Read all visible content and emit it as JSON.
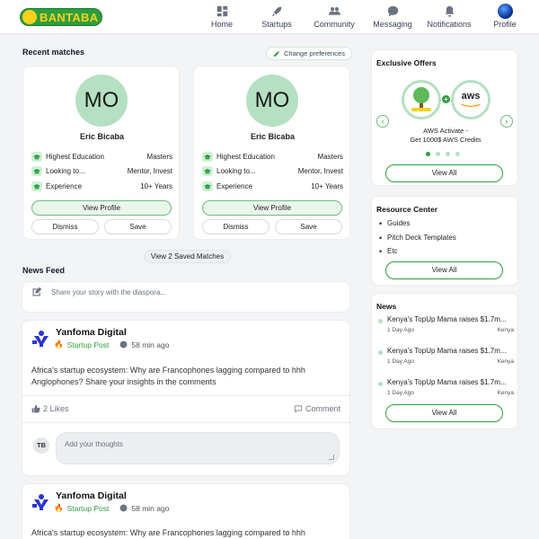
{
  "brand": {
    "name": "BANTABA",
    "primary": "#2e9e3e",
    "accent": "#f7d11e",
    "soft": "#b5e0c2"
  },
  "nav": [
    {
      "label": "Home",
      "icon": "home-icon"
    },
    {
      "label": "Startups",
      "icon": "rocket-icon"
    },
    {
      "label": "Community",
      "icon": "community-icon"
    },
    {
      "label": "Messaging",
      "icon": "chat-icon"
    },
    {
      "label": "Notifications",
      "icon": "bell-icon"
    },
    {
      "label": "Profile",
      "icon": "avatar"
    }
  ],
  "recent_matches": {
    "title": "Recent matches",
    "change_prefs": "Change preferences",
    "cards": [
      {
        "initials": "MO",
        "name": "Eric Bicaba",
        "attrs": [
          {
            "label": "Highest Education",
            "value": "Masters"
          },
          {
            "label": "Looking to...",
            "value": "Mentor, Invest"
          },
          {
            "label": "Experience",
            "value": "10+ Years"
          }
        ],
        "view": "View Profile",
        "dismiss": "Dismiss",
        "save": "Save"
      },
      {
        "initials": "MO",
        "name": "Eric Bicaba",
        "attrs": [
          {
            "label": "Highest Education",
            "value": "Masters"
          },
          {
            "label": "Looking to...",
            "value": "Mentor, Invest"
          },
          {
            "label": "Experience",
            "value": "10+ Years"
          }
        ],
        "view": "View Profile",
        "dismiss": "Dismiss",
        "save": "Save"
      }
    ],
    "saved_btn": "View 2 Saved Matches"
  },
  "news_feed": {
    "title": "News Feed",
    "share_placeholder": "Share your story with the diaspora...",
    "posts": [
      {
        "author": "Yanfoma Digital",
        "tag": "Startup Post",
        "time": "58 min ago",
        "body": "Africa's startup ecosystem: Why are Francophones lagging compared to hhh Anglophones? Share your insights in the comments",
        "likes": "2 Likes",
        "comment": "Comment",
        "user_initials": "TB",
        "thought_placeholder": "Add your thoughts"
      },
      {
        "author": "Yanfoma Digital",
        "tag": "Startup Post",
        "time": "58 min ago",
        "body": "Africa's startup ecosystem: Why are Francophones lagging compared to hhh"
      }
    ]
  },
  "offers": {
    "title": "Exclusive Offers",
    "aws_label": "aws",
    "line1": "AWS Activate -",
    "line2": "Get 1000$ AWS Credits",
    "view_all": "View All"
  },
  "resources": {
    "title": "Resource Center",
    "items": [
      "Guides",
      "Pitch Deck Templates",
      "Etc"
    ],
    "view_all": "View All"
  },
  "news": {
    "title": "News",
    "items": [
      {
        "headline": "Kenya's TopUp Mama raises $1.7m...",
        "age": "1 Day Ago",
        "country": "Kenya"
      },
      {
        "headline": "Kenya's TopUp Mama raises $1.7m...",
        "age": "1 Day Ago",
        "country": "Kenya"
      },
      {
        "headline": "Kenya's TopUp Mama raises $1.7m...",
        "age": "1 Day Ago",
        "country": "Kenya"
      }
    ],
    "view_all": "View All"
  }
}
